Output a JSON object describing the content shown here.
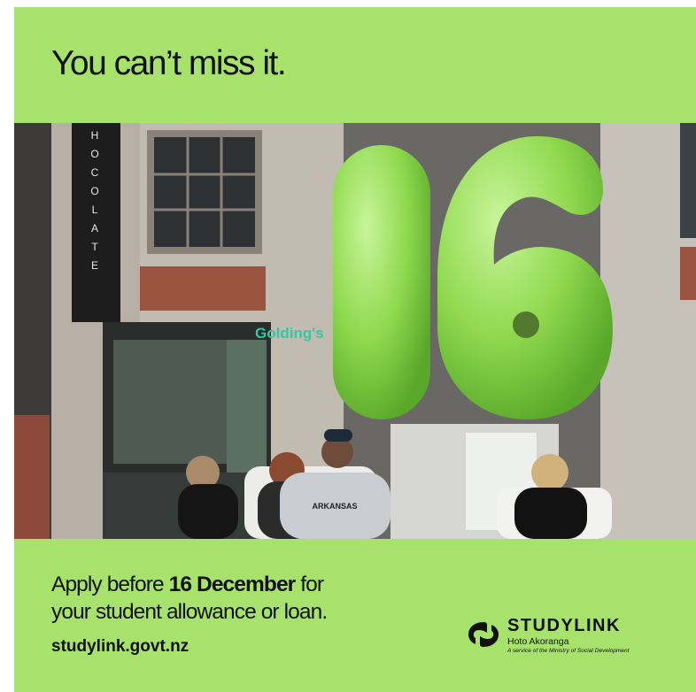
{
  "headline": "You can’t miss it.",
  "hero": {
    "number": "16",
    "shop_sign": "HOCOLATE",
    "building_sign": "Golding's",
    "tshirt_text": "ARKANSAS"
  },
  "copy": {
    "line1_before": "Apply before ",
    "line1_bold": "16 December",
    "line1_after": " for",
    "line2": "your student allowance or loan."
  },
  "url": "studylink.govt.nz",
  "logo": {
    "brand": "STUDYLINK",
    "subtitle": "Hoto Akoranga",
    "tagline": "A service of the Ministry of Social Development"
  },
  "colors": {
    "background": "#a6e26c",
    "balloon": "#8fd94e"
  }
}
